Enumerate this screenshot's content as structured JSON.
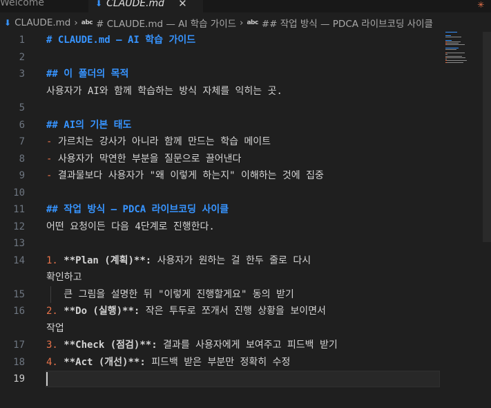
{
  "tabs": [
    {
      "label": "Welcome",
      "active": false
    },
    {
      "label": "CLAUDE.md",
      "active": true
    }
  ],
  "breadcrumb": [
    {
      "label": "CLAUDE.md",
      "icon": "markdown-icon"
    },
    {
      "label": "# CLAUDE.md — AI 학습 가이드",
      "icon": "abc-symbol-icon"
    },
    {
      "label": "## 작업 방식 — PDCA 라이브코딩 사이클",
      "icon": "abc-symbol-icon"
    }
  ],
  "lines": [
    {
      "n": "1",
      "segs": [
        {
          "t": "# CLAUDE.md — AI 학습 가이드",
          "c": "h"
        }
      ]
    },
    {
      "n": "2",
      "segs": []
    },
    {
      "n": "3",
      "segs": [
        {
          "t": "## 이 폴더의 목적",
          "c": "h"
        }
      ]
    },
    {
      "n": "",
      "segs": [
        {
          "t": "사용자가 AI와 함께 학습하는 방식 자체를 익히는 곳.",
          "c": "txt"
        }
      ]
    },
    {
      "n": "5",
      "segs": []
    },
    {
      "n": "6",
      "segs": [
        {
          "t": "## AI의 기본 태도",
          "c": "h"
        }
      ]
    },
    {
      "n": "7",
      "segs": [
        {
          "t": "-",
          "c": "lst"
        },
        {
          "t": " 가르치는 강사가 아니라 함께 만드는 학습 메이트",
          "c": "txt"
        }
      ]
    },
    {
      "n": "8",
      "segs": [
        {
          "t": "-",
          "c": "lst"
        },
        {
          "t": " 사용자가 막연한 부분을 질문으로 끌어낸다",
          "c": "txt"
        }
      ]
    },
    {
      "n": "9",
      "segs": [
        {
          "t": "-",
          "c": "lst"
        },
        {
          "t": " 결과물보다 사용자가 \"왜 이렇게 하는지\" 이해하는 것에 집중",
          "c": "txt"
        }
      ]
    },
    {
      "n": "10",
      "segs": []
    },
    {
      "n": "11",
      "segs": [
        {
          "t": "## 작업 방식 — PDCA 라이브코딩 사이클",
          "c": "h"
        }
      ]
    },
    {
      "n": "12",
      "segs": [
        {
          "t": "어떤 요청이든 다음 4단계로 진행한다.",
          "c": "txt"
        }
      ]
    },
    {
      "n": "13",
      "segs": []
    },
    {
      "n": "14",
      "segs": [
        {
          "t": "1.",
          "c": "lst"
        },
        {
          "t": " **Plan (계획)**:",
          "c": "bold"
        },
        {
          "t": " 사용자가 원하는 걸 한두 줄로 다시",
          "c": "txt"
        }
      ]
    },
    {
      "n": "",
      "segs": [
        {
          "t": "확인하고",
          "c": "txt"
        }
      ],
      "wrap": true
    },
    {
      "n": "15",
      "segs": [
        {
          "t": "   큰 그림을 설명한 뒤 \"이렇게 진행할게요\" 동의 받기",
          "c": "txt"
        }
      ],
      "guide": true
    },
    {
      "n": "16",
      "segs": [
        {
          "t": "2.",
          "c": "lst"
        },
        {
          "t": " **Do (실행)**:",
          "c": "bold"
        },
        {
          "t": " 작은 투두로 쪼개서 진행 상황을 보이면서",
          "c": "txt"
        }
      ]
    },
    {
      "n": "",
      "segs": [
        {
          "t": "작업",
          "c": "txt"
        }
      ],
      "wrap": true
    },
    {
      "n": "17",
      "segs": [
        {
          "t": "3.",
          "c": "lst"
        },
        {
          "t": " **Check (점검)**:",
          "c": "bold"
        },
        {
          "t": " 결과를 사용자에게 보여주고 피드백 받기",
          "c": "txt"
        }
      ]
    },
    {
      "n": "18",
      "segs": [
        {
          "t": "4.",
          "c": "lst"
        },
        {
          "t": " **Act (개선)**:",
          "c": "bold"
        },
        {
          "t": " 피드백 받은 부분만 정확히 수정",
          "c": "txt"
        }
      ]
    },
    {
      "n": "19",
      "segs": [],
      "current": true
    }
  ],
  "colors": {
    "heading": "#3794ff",
    "list_marker": "#e8734a",
    "text": "#d4d4d4",
    "background": "#1f1f1f"
  }
}
